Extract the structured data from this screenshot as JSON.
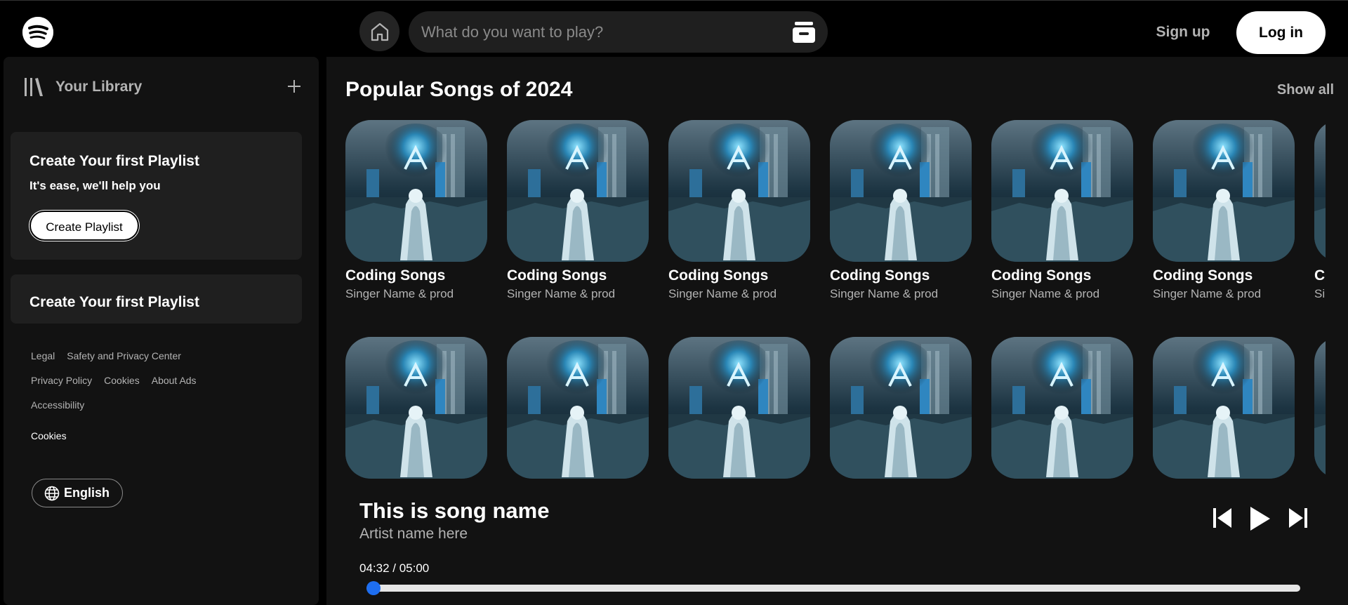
{
  "header": {
    "search_placeholder": "What do you want to play?",
    "signup_label": "Sign up",
    "login_label": "Log in"
  },
  "sidebar": {
    "library_title": "Your Library",
    "promo1": {
      "title": "Create Your first Playlist",
      "subtitle": "It's ease, we'll help you",
      "button_label": "Create Playlist"
    },
    "promo2": {
      "title": "Create Your first Playlist"
    },
    "footer_links": [
      [
        "Legal",
        "Safety and Privacy Center"
      ],
      [
        "Privacy Policy",
        "Cookies",
        "About Ads"
      ],
      [
        "Accessibility"
      ]
    ],
    "cookies_label": "Cookies",
    "language_label": "English"
  },
  "main": {
    "section_title": "Popular Songs of 2024",
    "show_all_label": "Show all",
    "rows": [
      [
        {
          "title": "Coding Songs",
          "subtitle": "Singer Name & prod"
        },
        {
          "title": "Coding Songs",
          "subtitle": "Singer Name & prod"
        },
        {
          "title": "Coding Songs",
          "subtitle": "Singer Name & prod"
        },
        {
          "title": "Coding Songs",
          "subtitle": "Singer Name & prod"
        },
        {
          "title": "Coding Songs",
          "subtitle": "Singer Name & prod"
        },
        {
          "title": "Coding Songs",
          "subtitle": "Singer Name & prod"
        },
        {
          "title": "Coding Songs",
          "subtitle": "Singer Name & prod"
        }
      ],
      [
        {
          "title": "",
          "subtitle": ""
        },
        {
          "title": "",
          "subtitle": ""
        },
        {
          "title": "",
          "subtitle": ""
        },
        {
          "title": "",
          "subtitle": ""
        },
        {
          "title": "",
          "subtitle": ""
        },
        {
          "title": "",
          "subtitle": ""
        },
        {
          "title": "",
          "subtitle": ""
        }
      ]
    ]
  },
  "player": {
    "song_name": "This is song name",
    "artist_name": "Artist name here",
    "time_display": "04:32 / 05:00",
    "progress_fraction": 0.0
  },
  "colors": {
    "background": "#000000",
    "panel": "#121212",
    "card": "#1f1f1f",
    "accent": "#1e6ef0",
    "muted_text": "#b3b3b3"
  },
  "icons": [
    "spotify-logo-icon",
    "home-icon",
    "browse-icon",
    "library-icon",
    "plus-icon",
    "globe-icon",
    "previous-icon",
    "play-icon",
    "next-icon"
  ]
}
